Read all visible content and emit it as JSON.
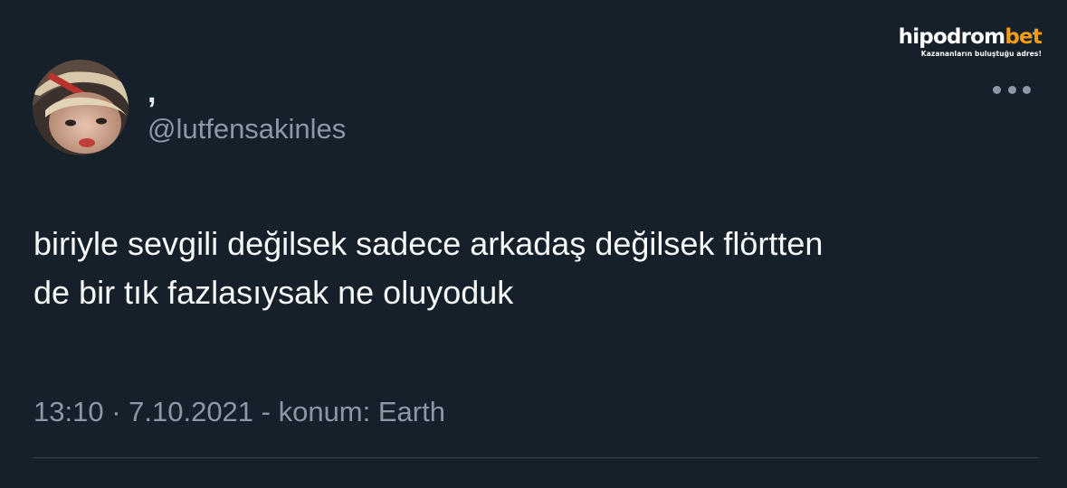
{
  "brand": {
    "logo_main": "hipodrom",
    "logo_accent": "bet",
    "slogan": "Kazananların buluştuğu adres!"
  },
  "tweet": {
    "display_name": ",",
    "handle": "@lutfensakinles",
    "text_line1": "biriyle sevgili değilsek sadece arkadaş değilsek flörtten",
    "text_line2": "de bir tık fazlasıysak ne oluyoduk",
    "meta": "13:10 · 7.10.2021 - konum: Earth"
  },
  "icons": {
    "more": "more-horizontal-icon",
    "avatar": "profile-avatar"
  },
  "colors": {
    "background": "#15202b",
    "text_primary": "#f7f9f9",
    "text_secondary": "#8b98a5",
    "brand_accent": "#f39c19",
    "divider": "#38444d"
  }
}
